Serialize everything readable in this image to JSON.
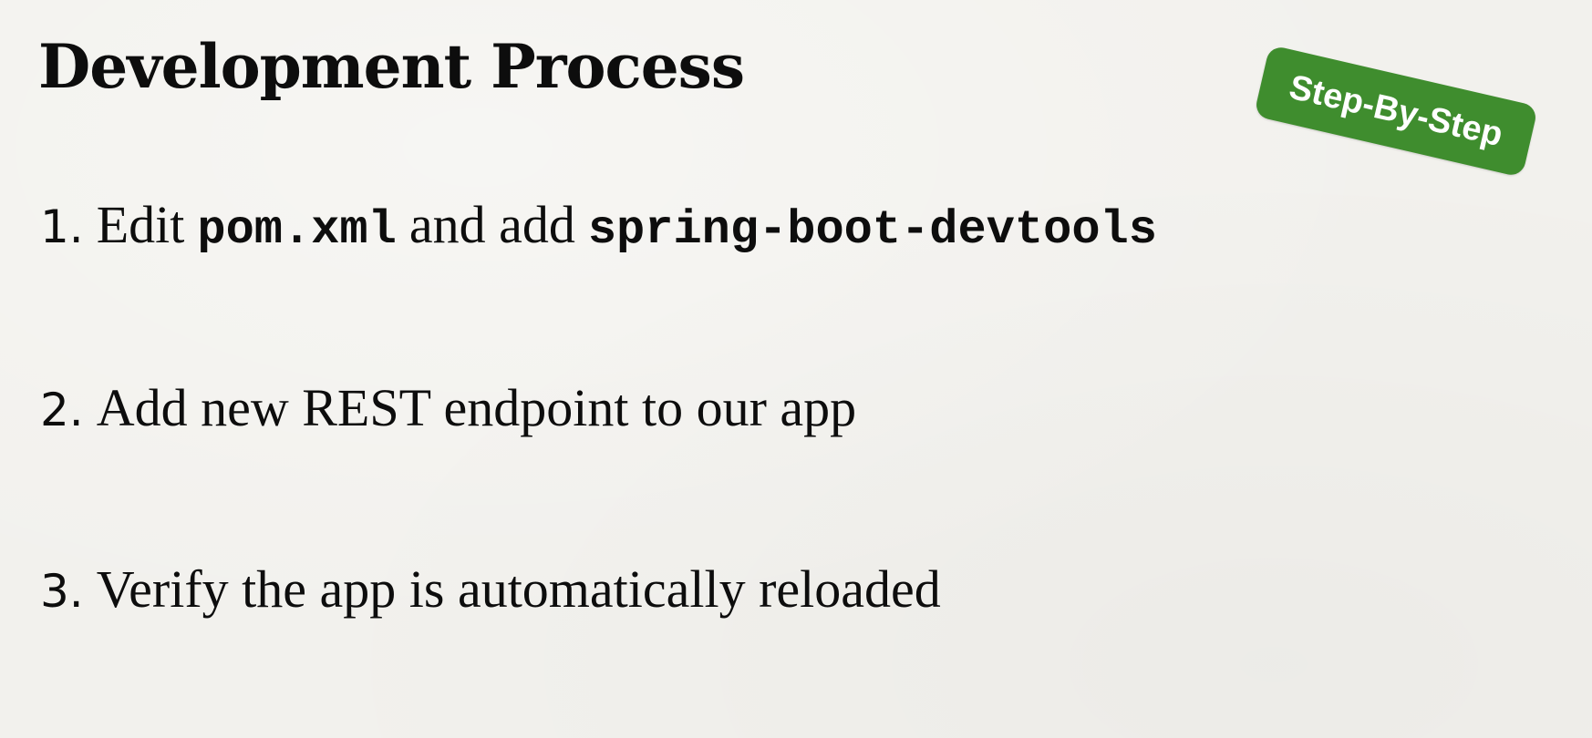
{
  "slide": {
    "title": "Development Process",
    "badge": "Step-By-Step",
    "steps": [
      {
        "number": "1.",
        "text_before": "Edit",
        "code_1": "pom.xml",
        "text_middle": "and add",
        "code_2": "spring-boot-devtools"
      },
      {
        "number": "2.",
        "text": "Add new REST endpoint to our app"
      },
      {
        "number": "3.",
        "text": "Verify the app is automatically reloaded"
      }
    ]
  },
  "colors": {
    "background": "#f2f1ed",
    "text": "#0d0d0d",
    "badge_background": "#3f8d2e",
    "badge_text": "#ffffff"
  }
}
